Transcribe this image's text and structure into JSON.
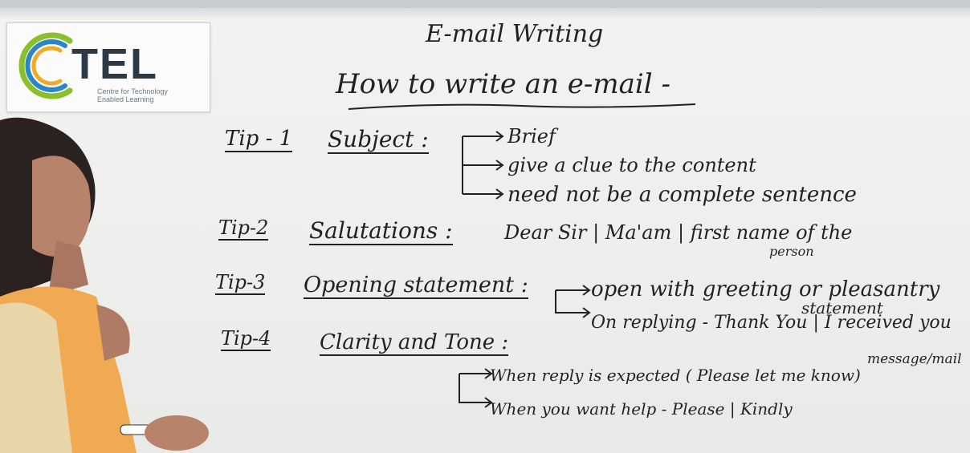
{
  "logo": {
    "brand": "TEL",
    "subtitle_line1": "Centre for Technology",
    "subtitle_line2": "Enabled Learning"
  },
  "board": {
    "title": "E-mail Writing",
    "heading": "How to write an e-mail -",
    "tip1": {
      "label": "Tip - 1",
      "topic": "Subject :",
      "points": [
        "Brief",
        "give a clue to the content",
        "need not be a complete sentence"
      ]
    },
    "tip2": {
      "label": "Tip-2",
      "topic": "Salutations :",
      "text": "Dear Sir | Ma'am | first name of the",
      "text2": "person"
    },
    "tip3": {
      "label": "Tip-3",
      "topic": "Opening statement :",
      "point1": "open with greeting or pleasantry",
      "point1b": "statement",
      "point2": "On replying - Thank You | I received you",
      "point2b": "message/mail"
    },
    "tip4": {
      "label": "Tip-4",
      "topic": "Clarity and Tone :",
      "point1": "When reply is expected ( Please let me know)",
      "point2": "When you want help - Please | Kindly"
    }
  }
}
